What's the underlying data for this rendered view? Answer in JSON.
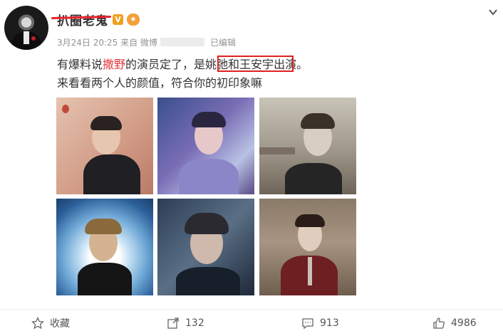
{
  "post": {
    "author": "扒圈老鬼",
    "meta_date": "3月24日 20:25 来自 微博",
    "meta_edited": "已编辑",
    "line1_part1": "有爆料说",
    "line1_highlight": "撒野",
    "line1_part2": "的演员定了，是",
    "line1_boxed": "姚弛和王安宇",
    "line1_part3": "出演。",
    "line2": "来看看两个人的颜值，符合你的初印象嘛"
  },
  "actions": {
    "favorite_label": "收藏",
    "repost_count": "132",
    "comment_count": "913",
    "like_count": "4986"
  },
  "colors": {
    "accent_red": "#e02020",
    "highlight_red": "#e4393c",
    "meta_gray": "#939393"
  },
  "icons": [
    "chevron-down-icon",
    "star-icon",
    "repost-icon",
    "comment-icon",
    "thumbs-up-icon"
  ]
}
